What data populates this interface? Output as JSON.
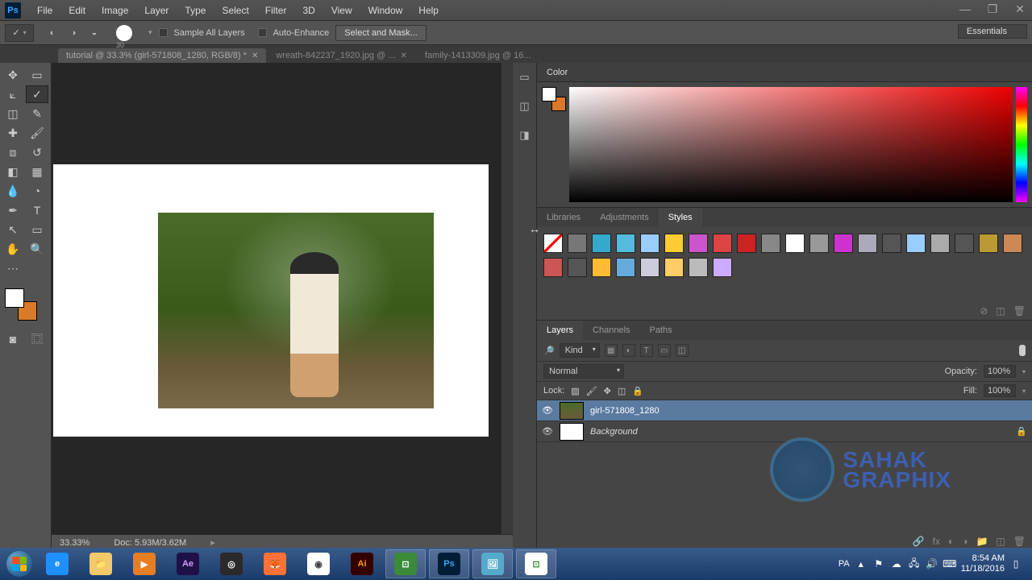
{
  "menu": [
    "File",
    "Edit",
    "Image",
    "Layer",
    "Type",
    "Select",
    "Filter",
    "3D",
    "View",
    "Window",
    "Help"
  ],
  "options": {
    "brush_size": "30",
    "sample_all": "Sample All Layers",
    "auto_enhance": "Auto-Enhance",
    "select_mask": "Select and Mask...",
    "workspace": "Essentials"
  },
  "tabs": [
    {
      "label": "tutorial @ 33.3% (girl-571808_1280, RGB/8) *",
      "active": true
    },
    {
      "label": "wreath-842237_1920.jpg @ ...",
      "active": false
    },
    {
      "label": "family-1413309.jpg @ 16...",
      "active": false
    }
  ],
  "status": {
    "zoom": "33.33%",
    "doc": "Doc: 5.93M/3.62M"
  },
  "color_panel": {
    "title": "Color"
  },
  "styles_tabs": [
    "Libraries",
    "Adjustments",
    "Styles"
  ],
  "styles_active": 2,
  "style_colors": [
    "#fff",
    "#777",
    "#3ac",
    "#5bd",
    "#9cf",
    "#fc3",
    "#c5c",
    "#d44",
    "#c22",
    "#888",
    "#fff",
    "#999",
    "#c3c",
    "#aab",
    "#555",
    "#9cf",
    "#aaa",
    "#555",
    "#b93",
    "#c85",
    "#c55",
    "#555",
    "#fb3",
    "#6ad",
    "#ccd",
    "#fc6",
    "#bbb",
    "#caf"
  ],
  "layers_tabs": [
    "Layers",
    "Channels",
    "Paths"
  ],
  "layers_active": 0,
  "layers": {
    "kind": "Kind",
    "blend": "Normal",
    "opacity_label": "Opacity:",
    "opacity": "100%",
    "lock_label": "Lock:",
    "fill_label": "Fill:",
    "fill": "100%",
    "items": [
      {
        "name": "girl-571808_1280",
        "selected": true,
        "bg": false
      },
      {
        "name": "Background",
        "selected": false,
        "bg": true
      }
    ]
  },
  "watermark": {
    "line1": "SAHAK",
    "line2": "GRAPHIX"
  },
  "taskbar": {
    "lang": "PA",
    "time": "8:54 AM",
    "date": "11/18/2016"
  }
}
